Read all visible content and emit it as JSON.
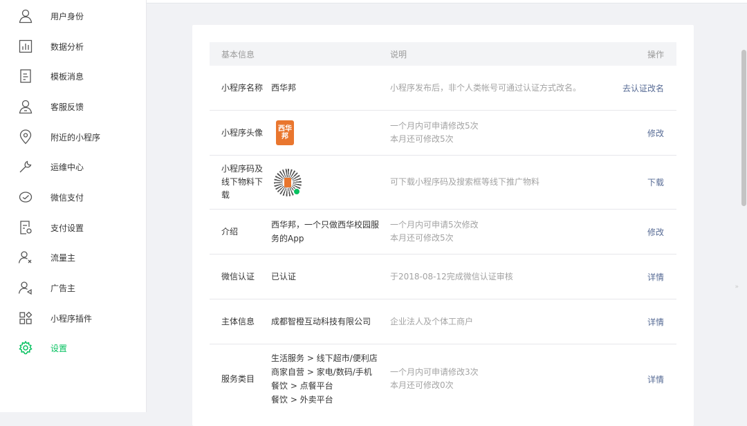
{
  "sidebar": {
    "items": [
      {
        "label": "用户身份",
        "icon": "user-icon"
      },
      {
        "label": "数据分析",
        "icon": "bar-chart-icon"
      },
      {
        "label": "模板消息",
        "icon": "document-icon"
      },
      {
        "label": "客服反馈",
        "icon": "customer-service-icon"
      },
      {
        "label": "附近的小程序",
        "icon": "location-pin-icon"
      },
      {
        "label": "运维中心",
        "icon": "wrench-icon"
      },
      {
        "label": "微信支付",
        "icon": "wechat-pay-icon"
      },
      {
        "label": "支付设置",
        "icon": "payment-settings-icon"
      },
      {
        "label": "流量主",
        "icon": "traffic-owner-icon"
      },
      {
        "label": "广告主",
        "icon": "advertiser-icon"
      },
      {
        "label": "小程序插件",
        "icon": "plugin-icon"
      },
      {
        "label": "设置",
        "icon": "gear-icon"
      }
    ],
    "active_color": "#07c160"
  },
  "table": {
    "headers": {
      "basic": "基本信息",
      "desc": "说明",
      "op": "操作"
    },
    "rows": [
      {
        "label": "小程序名称",
        "value": "西华邦",
        "desc": [
          "小程序发布后，非个人类帐号可通过认证方式改名。"
        ],
        "op": "去认证改名"
      },
      {
        "label": "小程序头像",
        "value_image": "西华邦",
        "desc": [
          "一个月内可申请修改5次",
          "本月还可修改5次"
        ],
        "op": "修改"
      },
      {
        "label": "小程序码及线下物料下载",
        "value_image": "qr-code",
        "desc": [
          "可下载小程序码及搜索框等线下推广物料"
        ],
        "op": "下载"
      },
      {
        "label": "介绍",
        "value": "西华邦，一个只做西华校园服务的App",
        "desc": [
          "一个月内可申请5次修改",
          "本月还可修改5次"
        ],
        "op": "修改"
      },
      {
        "label": "微信认证",
        "value": "已认证",
        "desc": [
          "于2018-08-12完成微信认证审核"
        ],
        "op": "详情"
      },
      {
        "label": "主体信息",
        "value": "成都智橙互动科技有限公司",
        "desc": [
          "企业法人及个体工商户"
        ],
        "op": "详情"
      },
      {
        "label": "服务类目",
        "value_lines": [
          "生活服务 > 线下超市/便利店",
          "商家自营 > 家电/数码/手机",
          "餐饮 > 点餐平台",
          "餐饮 > 外卖平台"
        ],
        "desc": [
          "一个月内可申请修改3次",
          "本月还可修改0次"
        ],
        "op": "详情"
      }
    ]
  },
  "colors": {
    "link": "#576b95",
    "muted": "#a3a3a3",
    "accent": "#07c160",
    "avatar": "#e9762e"
  }
}
